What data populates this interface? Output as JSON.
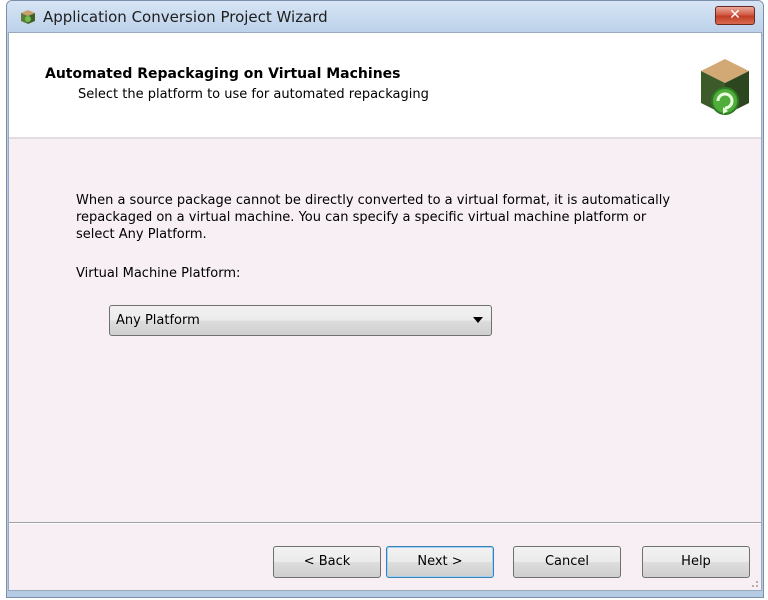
{
  "window": {
    "title": "Application Conversion Project Wizard",
    "close_label": "✕"
  },
  "header": {
    "title": "Automated Repackaging on Virtual Machines",
    "subtitle": "Select the platform to use for automated repackaging"
  },
  "body": {
    "description": "When a source package cannot be directly converted to a virtual format, it is automatically repackaged on a virtual machine.  You can specify a specific virtual machine platform or select Any Platform.",
    "platform_label": "Virtual Machine Platform:",
    "platform_value": "Any Platform"
  },
  "buttons": {
    "back": "< Back",
    "next": "Next >",
    "cancel": "Cancel",
    "help": "Help"
  },
  "icons": {
    "app": "package-icon",
    "header": "virtual-package-icon",
    "close": "close-icon",
    "dropdown": "chevron-down-icon"
  },
  "colors": {
    "header_bg": "#ffffff",
    "client_bg": "#f7eff3",
    "close_button": "#c23a22",
    "default_button_border": "#3c7fb1"
  }
}
